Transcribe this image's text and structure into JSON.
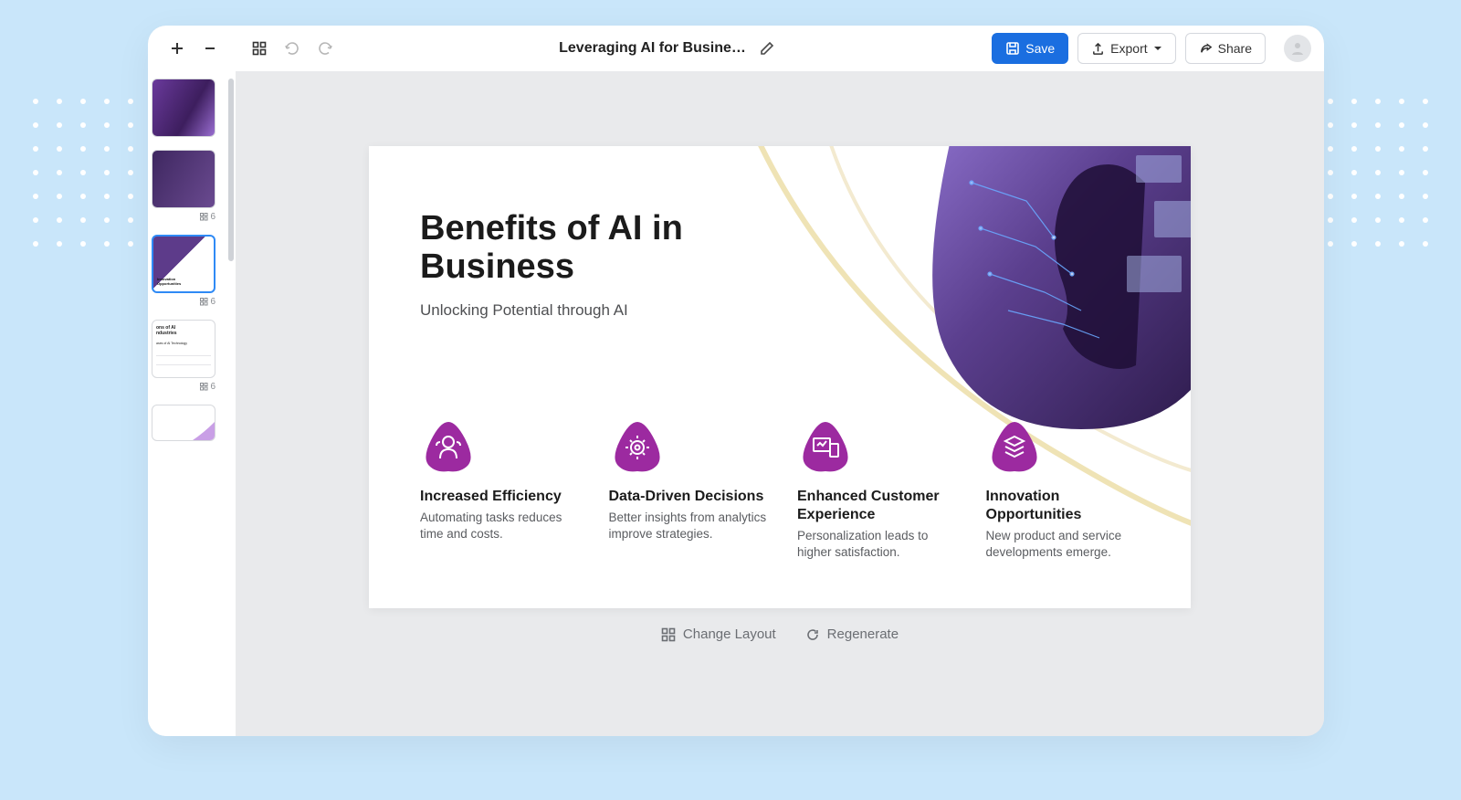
{
  "toolbar": {
    "title": "Leveraging AI for Busines…",
    "save": "Save",
    "export": "Export",
    "share": "Share"
  },
  "thumbnails": {
    "badge": "6"
  },
  "slide": {
    "title_line1": "Benefits of AI in",
    "title_line2": "Business",
    "subtitle": "Unlocking Potential through AI",
    "features": [
      {
        "title": "Increased Efficiency",
        "desc": "Automating tasks reduces time and costs."
      },
      {
        "title": "Data-Driven Decisions",
        "desc": "Better insights from analytics improve strategies."
      },
      {
        "title": "Enhanced Customer Experience",
        "desc": "Personalization leads to higher satisfaction."
      },
      {
        "title": "Innovation Opportunities",
        "desc": "New product and service developments emerge."
      }
    ]
  },
  "actions": {
    "layout": "Change Layout",
    "regen": "Regenerate"
  },
  "thumb4": {
    "title_a": "ons of AI",
    "title_b": "ndustries",
    "sub": "ases of AI Technology"
  }
}
